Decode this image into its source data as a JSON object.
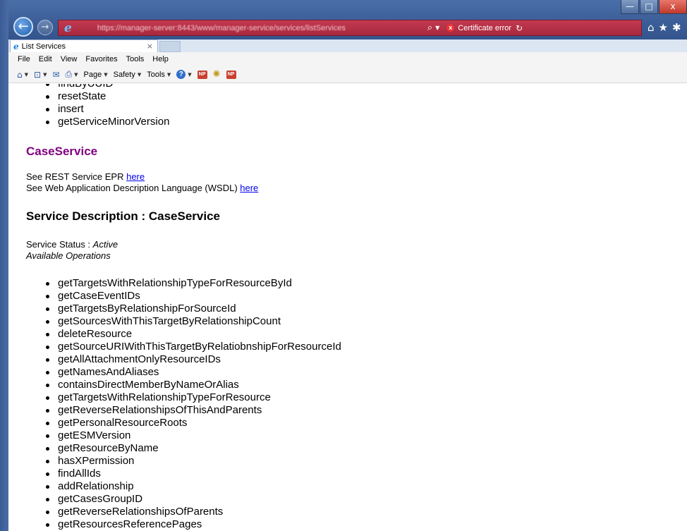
{
  "window": {
    "minimize_glyph": "—",
    "maximize_glyph": "□",
    "close_glyph": "x"
  },
  "nav": {
    "back_glyph": "←",
    "forward_glyph": "→"
  },
  "address": {
    "url": "https://manager-server:8443/www/manager-service/services/listServices",
    "search_glyph": "⌕",
    "dropdown_glyph": "▼",
    "cert_glyph": "x",
    "cert_text": "Certificate error",
    "refresh_glyph": "↻"
  },
  "toolbar_right": {
    "home_glyph": "⌂",
    "favorites_glyph": "★",
    "settings_glyph": "✱"
  },
  "tab": {
    "title": "List Services",
    "close_glyph": "×"
  },
  "menu": [
    "File",
    "Edit",
    "View",
    "Favorites",
    "Tools",
    "Help"
  ],
  "commandbar": {
    "home_glyph": "⌂",
    "feeds_glyph": "⊡",
    "mail_glyph": "✉",
    "print_glyph": "⎙",
    "page_label": "Page",
    "safety_label": "Safety",
    "tools_label": "Tools",
    "help_glyph": "?",
    "addon1_text": "NP",
    "gear_glyph": "✺",
    "addon2_text": "NP"
  },
  "content": {
    "top_operations": [
      "findByUUID",
      "resetState",
      "insert",
      "getServiceMinorVersion"
    ],
    "service_name": "CaseService",
    "epr_prefix": "See REST Service EPR ",
    "epr_link": "here",
    "wsdl_prefix": "See Web Application Description Language (WSDL) ",
    "wsdl_link": "here",
    "description_heading": "Service Description : CaseService",
    "status_label": "Service Status : ",
    "status_value": "Active",
    "available_operations": "Available Operations",
    "operations": [
      "getTargetsWithRelationshipTypeForResourceById",
      "getCaseEventIDs",
      "getTargetsByRelationshipForSourceId",
      "getSourcesWithThisTargetByRelationshipCount",
      "deleteResource",
      "getSourceURIWithThisTargetByRelatiobnshipForResourceId",
      "getAllAttachmentOnlyResourceIDs",
      "getNamesAndAliases",
      "containsDirectMemberByNameOrAlias",
      "getTargetsWithRelationshipTypeForResource",
      "getReverseRelationshipsOfThisAndParents",
      "getPersonalResourceRoots",
      "getESMVersion",
      "getResourceByName",
      "hasXPermission",
      "findAllIds",
      "addRelationship",
      "getCasesGroupID",
      "getReverseRelationshipsOfParents",
      "getResourcesReferencePages"
    ]
  }
}
